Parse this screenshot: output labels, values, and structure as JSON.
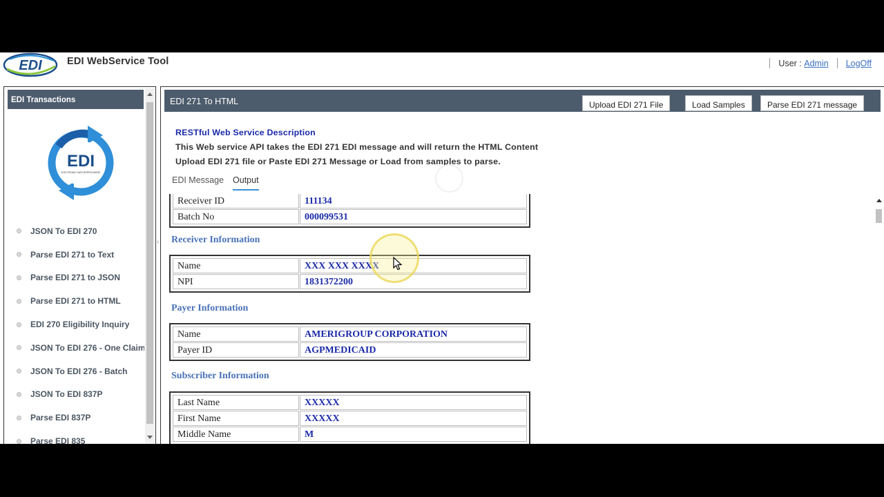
{
  "header": {
    "logo_text": "EDI",
    "app_title": "EDI WebService Tool",
    "user_label": "User :",
    "user_name": "Admin",
    "logoff": "LogOff"
  },
  "sidebar": {
    "title": "EDI Transactions",
    "logo_text": "EDI",
    "logo_subtext": "ELECTRONIC DATA INTERCHANGE",
    "items": [
      {
        "label": "JSON To EDI 270"
      },
      {
        "label": "Parse EDI 271 to Text"
      },
      {
        "label": "Parse EDI 271 to JSON"
      },
      {
        "label": "Parse EDI 271 to HTML"
      },
      {
        "label": "EDI 270 Eligibility Inquiry"
      },
      {
        "label": "JSON To EDI 276 - One Claim"
      },
      {
        "label": "JSON To EDI 276 - Batch"
      },
      {
        "label": "JSON To EDI 837P"
      },
      {
        "label": "Parse EDI 837P"
      },
      {
        "label": "Parse EDI 835"
      }
    ]
  },
  "toolbar": {
    "title": "EDI 271 To HTML",
    "upload_label": "Upload EDI 271 File",
    "samples_label": "Load Samples",
    "parse_label": "Parse EDI 271 message"
  },
  "description": {
    "title": "RESTful Web Service Description",
    "line1": "This Web service API takes the EDI 271 EDI message and will return the HTML Content",
    "line2": "Upload EDI 271 file or Paste EDI 271 Message or Load from samples to parse."
  },
  "tabs": [
    {
      "label": "EDI Message",
      "active": false
    },
    {
      "label": "Output",
      "active": true
    }
  ],
  "output": {
    "header_rows": [
      {
        "key": "Receiver ID",
        "value": "111134"
      },
      {
        "key": "Batch No",
        "value": "000099531"
      }
    ],
    "receiver": {
      "title": "Receiver Information",
      "rows": [
        {
          "key": "Name",
          "value": "XXX XXX XXXX"
        },
        {
          "key": "NPI",
          "value": "1831372200"
        }
      ]
    },
    "payer": {
      "title": "Payer Information",
      "rows": [
        {
          "key": "Name",
          "value": "AMERIGROUP CORPORATION"
        },
        {
          "key": "Payer ID",
          "value": "AGPMEDICAID"
        }
      ]
    },
    "subscriber": {
      "title": "Subscriber Information",
      "rows": [
        {
          "key": "Last Name",
          "value": "XXXXX"
        },
        {
          "key": "First Name",
          "value": "XXXXX"
        },
        {
          "key": "Middle Name",
          "value": "M"
        }
      ]
    }
  },
  "colors": {
    "toolbar_bg": "#4d5c6c",
    "value_text": "#1a2aa8",
    "section_title": "#4a72b8",
    "link": "#3b6fbf",
    "tab_underline": "#3b8fd6"
  }
}
